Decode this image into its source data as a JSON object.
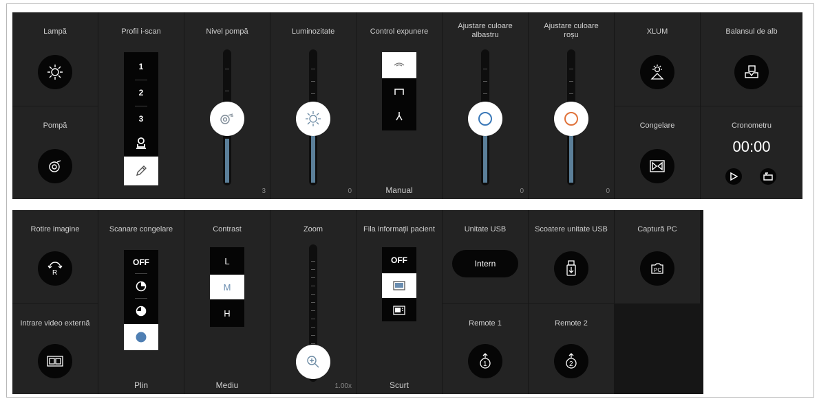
{
  "row1": {
    "lampa": {
      "label": "Lampă",
      "icon": "lamp-icon"
    },
    "pompa": {
      "label": "Pompă",
      "icon": "pump-icon"
    },
    "profil": {
      "label": "Profil i-scan",
      "options": [
        "1",
        "2",
        "3"
      ],
      "selected_icon": "pencil-icon",
      "user_icon": "user-profile-icon"
    },
    "nivel_pompa": {
      "label": "Nivel pompă",
      "value": "3",
      "level_fraction": 0.45
    },
    "luminozitate": {
      "label": "Luminozitate",
      "value": "0",
      "level_fraction": 0.5
    },
    "control_expunere": {
      "label": "Control expunere",
      "mode": "Manual"
    },
    "ajustare_albastru": {
      "label": "Ajustare culoare\nalbastru",
      "value": "0",
      "level_fraction": 0.5
    },
    "ajustare_rosu": {
      "label": "Ajustare culoare\nroșu",
      "value": "0",
      "level_fraction": 0.5
    },
    "xlum": {
      "label": "XLUM"
    },
    "congelare": {
      "label": "Congelare"
    },
    "balans": {
      "label": "Balansul de alb"
    },
    "cronometru": {
      "label": "Cronometru",
      "time": "00:00"
    }
  },
  "row2": {
    "rotire": {
      "label": "Rotire imagine"
    },
    "intrare_video": {
      "label": "Intrare video externă"
    },
    "scanare": {
      "label": "Scanare congelare",
      "off": "OFF",
      "mode": "Plin"
    },
    "contrast": {
      "label": "Contrast",
      "options": [
        "L",
        "M",
        "H"
      ],
      "selected": "M",
      "mode": "Mediu"
    },
    "zoom": {
      "label": "Zoom",
      "value": "1.00x"
    },
    "fila": {
      "label": "Fila informații pacient",
      "off": "OFF",
      "mode": "Scurt"
    },
    "unitate_usb": {
      "label": "Unitate USB",
      "value": "Intern"
    },
    "scoatere_usb": {
      "label": "Scoatere unitate USB"
    },
    "remote1": {
      "label": "Remote 1"
    },
    "remote2": {
      "label": "Remote 2"
    },
    "captura": {
      "label": "Captură PC"
    }
  },
  "colors": {
    "tile": "#232323",
    "panel": "#161616",
    "slider_fill": "#5b7f99",
    "blue_ring": "#3a78b8",
    "red_ring": "#e0723a"
  }
}
